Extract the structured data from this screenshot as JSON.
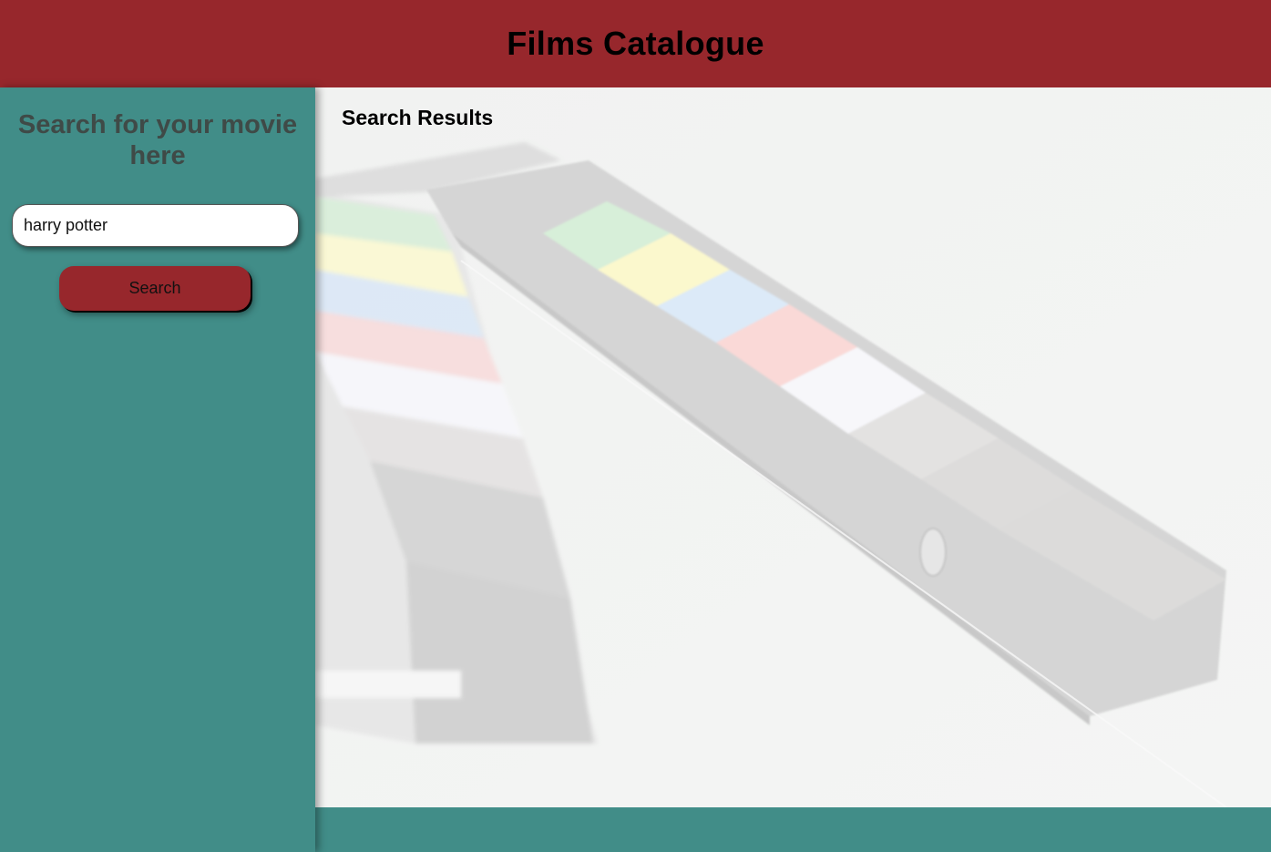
{
  "header": {
    "title": "Films Catalogue"
  },
  "sidebar": {
    "heading": "Search for your movie here",
    "search_input_value": "harry potter",
    "search_button_label": "Search"
  },
  "main": {
    "results_title": "Search Results"
  },
  "colors": {
    "header_bg": "#97272c",
    "sidebar_bg": "#418d88",
    "button_bg": "#97272c",
    "main_bg": "#eff1f0"
  }
}
